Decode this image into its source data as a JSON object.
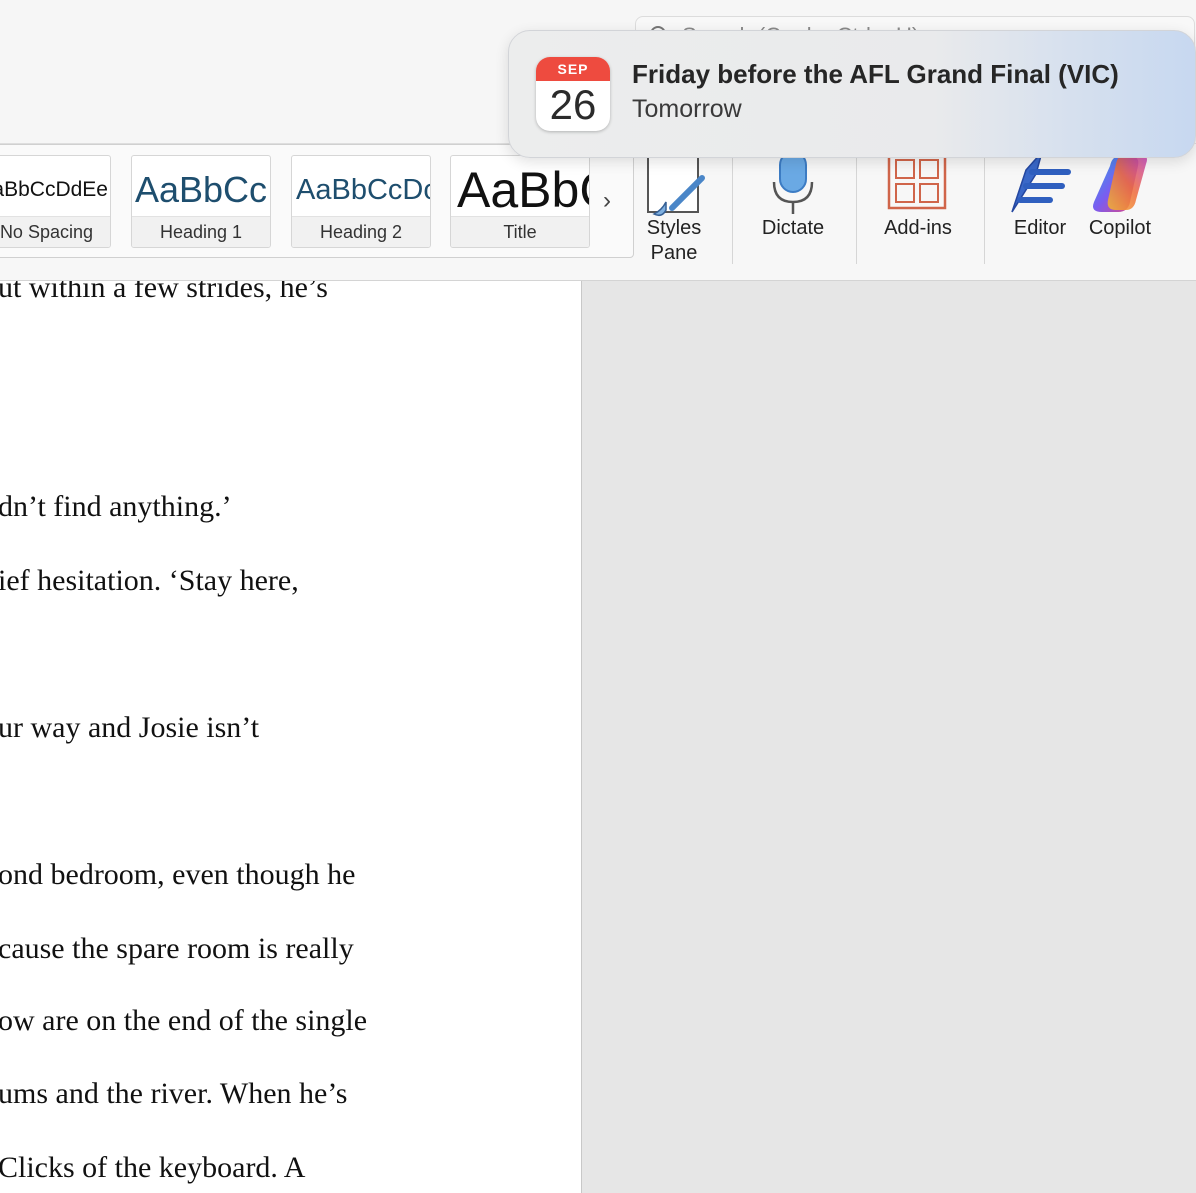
{
  "search": {
    "placeholder": "Search (Cmd + Ctrl + U)"
  },
  "styles_gallery": {
    "tiles": [
      {
        "preview": "AaBbCcDdEe",
        "label": "No Spacing"
      },
      {
        "preview": "AaBbCc",
        "label": "Heading 1"
      },
      {
        "preview": "AaBbCcDc",
        "label": "Heading 2"
      },
      {
        "preview": "AaBbC",
        "label": "Title"
      }
    ],
    "more_glyph": "›"
  },
  "ribbon": {
    "styles_pane": {
      "line1": "Styles",
      "line2": "Pane",
      "icon": "paintbrush-icon"
    },
    "dictate": {
      "label": "Dictate",
      "icon": "microphone-icon"
    },
    "addins": {
      "label": "Add-ins",
      "icon": "grid-icon"
    },
    "editor": {
      "label": "Editor",
      "icon": "pen-icon"
    },
    "copilot": {
      "label": "Copilot",
      "icon": "copilot-icon"
    }
  },
  "document": {
    "lines": [
      "ut within a few strides, he’s",
      "dn’t find anything.’",
      "ief hesitation. ‘Stay here,",
      "ur way and Josie isn’t",
      "ond bedroom, even though he",
      "cause the spare room is really",
      "ow are on the end of the single",
      "ums and the river. When he’s",
      "Clicks of the keyboard. A"
    ]
  },
  "notification": {
    "icon": "calendar-icon",
    "month": "SEP",
    "day": "26",
    "title": "Friday before the AFL Grand Final (VIC)",
    "subtitle": "Tomorrow"
  },
  "colors": {
    "heading_blue": "#1e4e6e",
    "calendar_red": "#ee4b3f",
    "addins_orange": "#d0654a",
    "editor_blue": "#2f5fbf"
  }
}
